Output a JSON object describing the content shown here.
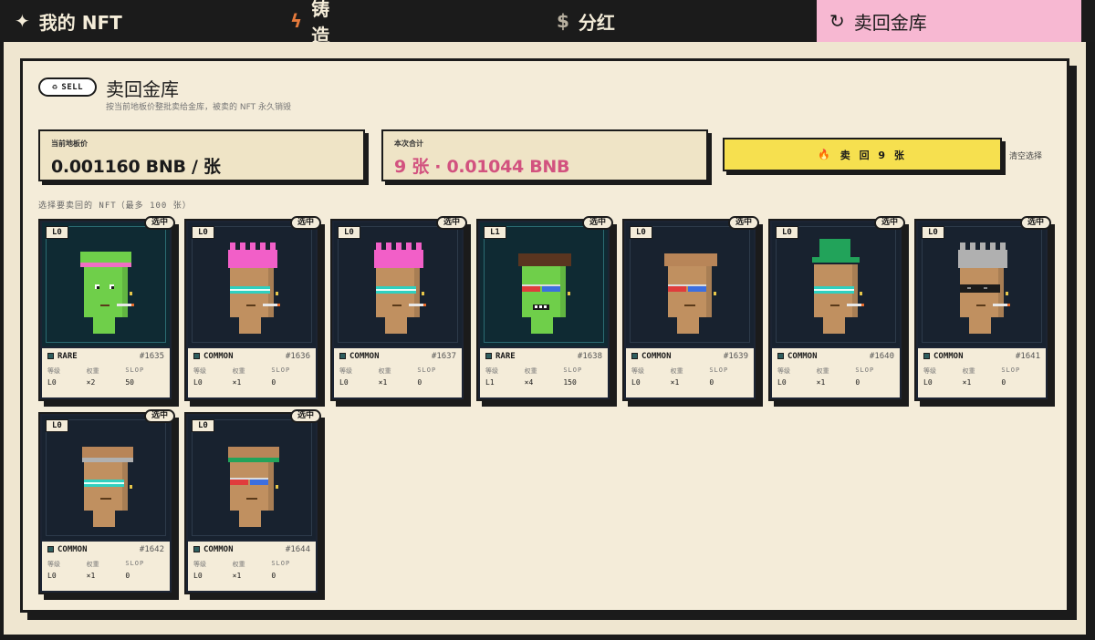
{
  "nav": {
    "tabs": [
      {
        "icon": "✦",
        "label": "我的 NFT"
      },
      {
        "icon": "ϟ",
        "label": "铸造"
      },
      {
        "icon": "$",
        "label": "分红"
      },
      {
        "icon": "↻",
        "label": "卖回金库"
      }
    ],
    "active_tab": 3
  },
  "header": {
    "badge": "SELL",
    "title": "卖回金库",
    "subtitle": "按当前地板价整批卖给金库，被卖的 NFT 永久销毁"
  },
  "stats": {
    "floor_label": "当前地板价",
    "floor_value": "0.001160 BNB / 张",
    "total_label": "本次合计",
    "total_value": "9 张 · 0.01044 BNB"
  },
  "actions": {
    "sell_label": "卖 回 9 张",
    "clear_label": "清空选择"
  },
  "grid_label": "选择要卖回的 NFT（最多 100 张）",
  "card_labels": {
    "level_head": "等级",
    "weight_head": "权重",
    "slop_head": "SLOP",
    "selected": "选中"
  },
  "cards": [
    {
      "level_tag": "L0",
      "rarity": "RARE",
      "id": "#1635",
      "level": "L0",
      "weight": "×2",
      "slop": "50"
    },
    {
      "level_tag": "L0",
      "rarity": "COMMON",
      "id": "#1636",
      "level": "L0",
      "weight": "×1",
      "slop": "0"
    },
    {
      "level_tag": "L0",
      "rarity": "COMMON",
      "id": "#1637",
      "level": "L0",
      "weight": "×1",
      "slop": "0"
    },
    {
      "level_tag": "L1",
      "rarity": "RARE",
      "id": "#1638",
      "level": "L1",
      "weight": "×4",
      "slop": "150"
    },
    {
      "level_tag": "L0",
      "rarity": "COMMON",
      "id": "#1639",
      "level": "L0",
      "weight": "×1",
      "slop": "0"
    },
    {
      "level_tag": "L0",
      "rarity": "COMMON",
      "id": "#1640",
      "level": "L0",
      "weight": "×1",
      "slop": "0"
    },
    {
      "level_tag": "L0",
      "rarity": "COMMON",
      "id": "#1641",
      "level": "L0",
      "weight": "×1",
      "slop": "0"
    },
    {
      "level_tag": "L0",
      "rarity": "COMMON",
      "id": "#1642",
      "level": "L0",
      "weight": "×1",
      "slop": "0"
    },
    {
      "level_tag": "L0",
      "rarity": "COMMON",
      "id": "#1644",
      "level": "L0",
      "weight": "×1",
      "slop": "0"
    }
  ],
  "colors": {
    "accent_pink": "#f7b8d2",
    "sell_yellow": "#f6e04f",
    "total_pink": "#d2527f"
  }
}
